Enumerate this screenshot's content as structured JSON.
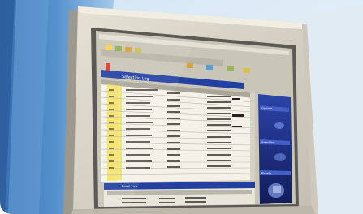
{
  "scene": {
    "subject": "crt-monitor-displaying-spreadsheet-application",
    "colors": {
      "wall_blue": "#2f6fb3",
      "wall_light": "#bcd7ef",
      "bezel": "#d8d3c6",
      "bezel_shadow": "#a39e92",
      "screen_bg": "#c9c6b8",
      "grid_bg": "#f4f2e8",
      "highlight_yellow": "#f3e15a",
      "right_panel": "#1e2f7e",
      "title_bar": "#2340a0"
    }
  },
  "screen": {
    "toolbar_label": "Selection Log",
    "sidebar_labels": [
      "Options",
      "Selection",
      "Details"
    ],
    "bottom_panel_label": "Detail view"
  }
}
